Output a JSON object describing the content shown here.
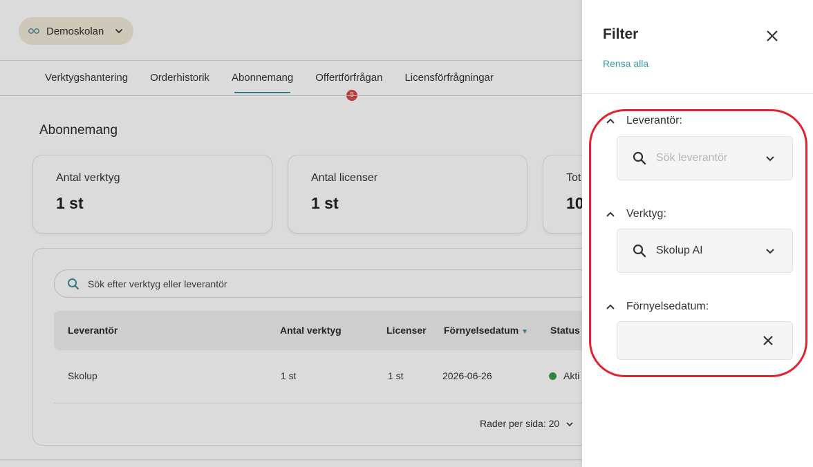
{
  "header": {
    "school_name": "Demoskolan"
  },
  "tabs": [
    {
      "label": "Verktygshantering"
    },
    {
      "label": "Orderhistorik"
    },
    {
      "label": "Abonnemang",
      "active": true
    },
    {
      "label": "Offertförfrågan",
      "badge": "5"
    },
    {
      "label": "Licensförfrågningar"
    }
  ],
  "page": {
    "title": "Abonnemang"
  },
  "stats": [
    {
      "label": "Antal verktyg",
      "value": "1 st"
    },
    {
      "label": "Antal licenser",
      "value": "1 st"
    },
    {
      "label": "Tot",
      "value": "10"
    }
  ],
  "table": {
    "search_placeholder": "Sök efter verktyg eller leverantör",
    "columns": [
      "Leverantör",
      "Antal verktyg",
      "Licenser",
      "Förnyelsedatum",
      "Status"
    ],
    "rows": [
      {
        "leverantor": "Skolup",
        "antal_verktyg": "1 st",
        "licenser": "1 st",
        "fornyelsedatum": "2026-06-26",
        "status": "Akti"
      }
    ],
    "rows_per_page_label": "Rader per sida: 20"
  },
  "filter": {
    "title": "Filter",
    "clear_all": "Rensa alla",
    "sections": {
      "supplier": {
        "label": "Leverantör:",
        "placeholder": "Sök leverantör"
      },
      "tool": {
        "label": "Verktyg:",
        "value": "Skolup AI"
      },
      "renewal": {
        "label": "Förnyelsedatum:"
      }
    }
  },
  "colors": {
    "accent": "#3a8fa0",
    "badge": "#d94848",
    "status_active": "#3c9a4b",
    "highlight": "#e0242f"
  }
}
